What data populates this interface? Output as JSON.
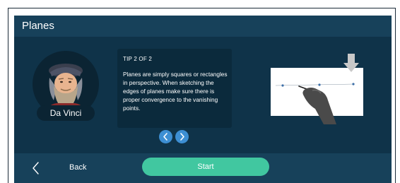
{
  "header": {
    "title": "Planes"
  },
  "character": {
    "name": "Da Vinci",
    "icon": "da-vinci-portrait"
  },
  "tip": {
    "counter": "TIP 2 OF 2",
    "text": "Planes are simply squares or rectangles in perspective. When sketching the edges of planes make sure there is proper convergence to the vanishing points."
  },
  "pager": {
    "prev_icon": "chevron-left-icon",
    "next_icon": "chevron-right-icon"
  },
  "footer": {
    "back_label": "Back",
    "start_label": "Start"
  },
  "colors": {
    "panel": "#0d2f44",
    "header": "#17415a",
    "accent": "#41c7a0",
    "pager": "#3d8fd3"
  }
}
